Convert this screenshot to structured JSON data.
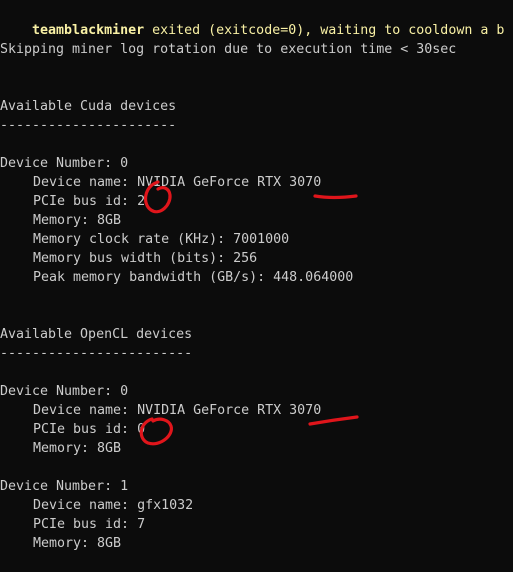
{
  "header": {
    "miner_name": "teamblackminer",
    "exit_message": " exited (exitcode=0), waiting to cooldown a b"
  },
  "log_rotation": "Skipping miner log rotation due to execution time < 30sec",
  "cuda": {
    "title": "Available Cuda devices",
    "divider": "----------------------",
    "devices": [
      {
        "number": "Device Number: 0",
        "name": "Device name: NVIDIA GeForce RTX 3070",
        "pcie": "PCIe bus id: 2",
        "memory": "Memory: 8GB",
        "clock": "Memory clock rate (KHz): 7001000",
        "bus_width": "Memory bus width (bits): 256",
        "bandwidth": "Peak memory bandwidth (GB/s): 448.064000"
      }
    ]
  },
  "opencl": {
    "title": "Available OpenCL devices",
    "divider": "------------------------",
    "devices": [
      {
        "number": "Device Number: 0",
        "name": "Device name: NVIDIA GeForce RTX 3070",
        "pcie": "PCIe bus id: 0",
        "memory": "Memory: 8GB"
      },
      {
        "number": "Device Number: 1",
        "name": "Device name: gfx1032",
        "pcie": "PCIe bus id: 7",
        "memory": "Memory: 8GB"
      }
    ]
  },
  "colors": {
    "background": "#0c0c0c",
    "text": "#cccccc",
    "highlight": "#f9f1a5",
    "annotation": "#e0151b"
  }
}
